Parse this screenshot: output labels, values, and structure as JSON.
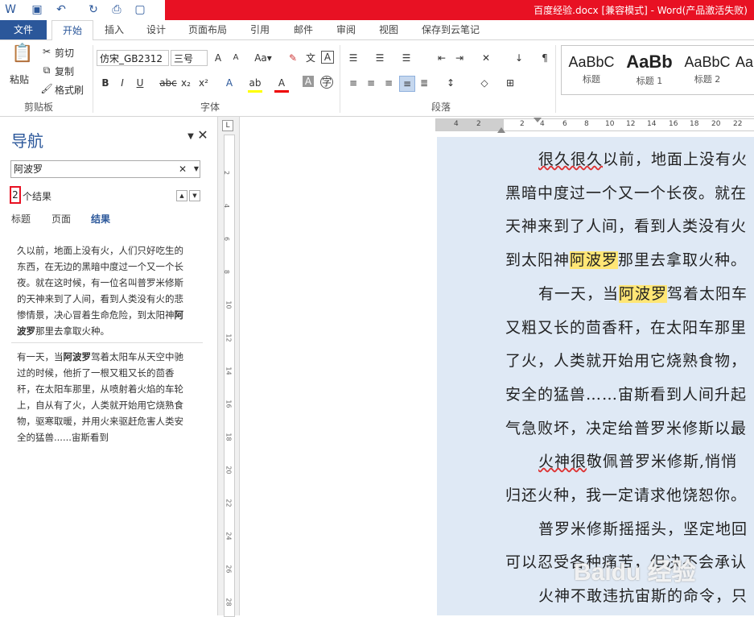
{
  "window": {
    "title": "百度经验.docx [兼容模式] - Word(产品激活失败)"
  },
  "quick_access": {
    "icons": [
      "word-icon",
      "save-icon",
      "undo-icon",
      "redo-icon",
      "print-preview-icon",
      "new-doc-icon"
    ]
  },
  "tabs": [
    "文件",
    "开始",
    "插入",
    "设计",
    "页面布局",
    "引用",
    "邮件",
    "审阅",
    "视图",
    "保存到云笔记"
  ],
  "ribbon": {
    "clipboard": {
      "paste": "粘贴",
      "cut": "剪切",
      "copy": "复制",
      "format_painter": "格式刷",
      "label": "剪贴板"
    },
    "font": {
      "name": "仿宋_GB2312",
      "size": "三号",
      "label": "字体"
    },
    "paragraph": {
      "label": "段落"
    },
    "styles": [
      {
        "preview": "AaBbC",
        "name": "标题"
      },
      {
        "preview": "AaBb",
        "name": "标题 1"
      },
      {
        "preview": "AaBbC",
        "name": "标题 2"
      },
      {
        "preview": "Aa",
        "name": ""
      }
    ]
  },
  "nav": {
    "title": "导航",
    "search_value": "阿波罗",
    "result_count": "2",
    "result_suffix": "个结果",
    "tabs": [
      "标题",
      "页面",
      "结果"
    ],
    "results": [
      {
        "before": "久以前，地面上没有火，人们只好吃生的东西，在无边的黑暗中度过一个又一个长夜。就在这时候，有一位名叫普罗米修斯的天神来到了人间，看到人类没有火的悲惨情景，决心冒着生命危险，到太阳神",
        "match": "阿波罗",
        "after": "那里去拿取火种。"
      },
      {
        "before": "有一天，当",
        "match": "阿波罗",
        "after": "驾着太阳车从天空中驰过的时候，他折了一根又粗又长的茴香秆，在太阳车那里，从喷射着火焰的车轮上，自从有了火，人类就开始用它烧熟食物，驱寒取暖，并用火来驱赶危害人类安全的猛兽......宙斯看到"
      }
    ]
  },
  "ruler": {
    "h_numbers": [
      "4",
      "2",
      "2",
      "4",
      "6",
      "8",
      "10",
      "12",
      "14",
      "16",
      "18",
      "20",
      "22"
    ],
    "v_numbers": [
      "2",
      "4",
      "6",
      "8",
      "10",
      "12",
      "14",
      "16",
      "18",
      "20",
      "22",
      "24",
      "26",
      "28"
    ]
  },
  "document": {
    "lines": [
      {
        "a": "很久很久",
        "b": "以前，地面上没有火"
      },
      {
        "a": "黑暗中度过一个又一个长夜。就在"
      },
      {
        "a": "天神来到了人间，看到人类没有火"
      },
      {
        "a": "到太阳神",
        "hl": "阿波罗",
        "b": "那里去拿取火种。"
      },
      {
        "a": "有一天，当",
        "hl": "阿波罗",
        "b": "驾着太阳车"
      },
      {
        "a": "又粗又长的茴香秆，在太阳车那里"
      },
      {
        "a": "了火，人类就开始用它烧熟食物，"
      },
      {
        "a": "安全的猛兽……宙斯看到人间升起"
      },
      {
        "a": "气急败坏，决定给普罗米修斯以最"
      },
      {
        "a": "火神很",
        "b": "敬佩普罗米修斯,悄悄"
      },
      {
        "a": "归还火种，我一定请求他饶恕你。"
      },
      {
        "a": "普罗米修斯摇摇头，坚定地回"
      },
      {
        "a": "可以忍受各种痛苦，但决不会承认"
      },
      {
        "a": "火神不敢违抗宙斯的命令，只"
      }
    ]
  },
  "watermark": "Baidu 经验"
}
